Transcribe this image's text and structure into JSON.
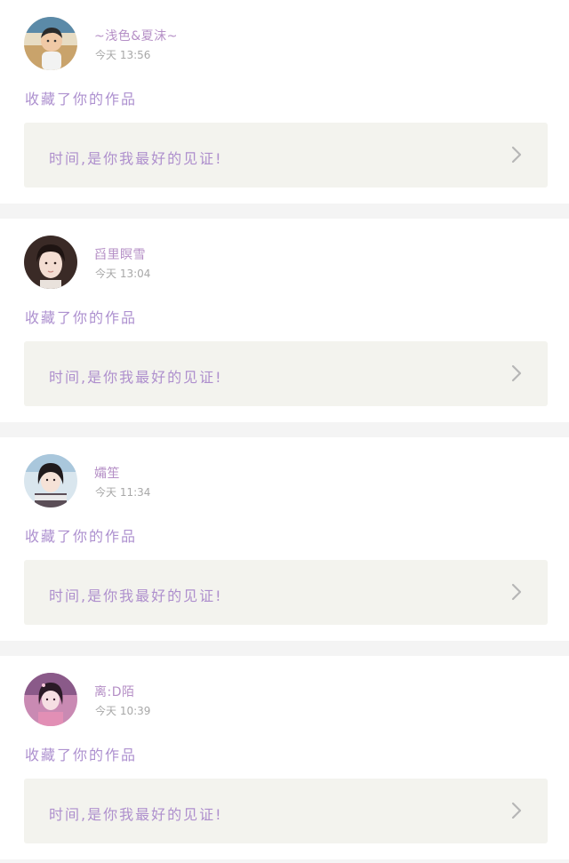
{
  "colors": {
    "name": "#b58fc6",
    "accent_text": "#ae8fcd",
    "time": "#a8a8a8",
    "card_bg": "#ffffff",
    "work_bg": "#f3f3ee",
    "divider": "#f4f4f4",
    "chevron": "#b6b6b6"
  },
  "notifications": [
    {
      "avatar": "boy-photo",
      "username": "~浅色&夏沫~",
      "time": "今天 13:56",
      "action": "收藏了你的作品",
      "work_title": "时间,是你我最好的见证!",
      "chevron_icon": "chevron-right-icon"
    },
    {
      "avatar": "woman-portrait",
      "username": "舀里瞑雪",
      "time": "今天 13:04",
      "action": "收藏了你的作品",
      "work_title": "时间,是你我最好的见证!",
      "chevron_icon": "chevron-right-icon"
    },
    {
      "avatar": "girl-photo",
      "username": "孀笙",
      "time": "今天 11:34",
      "action": "收藏了你的作品",
      "work_title": "时间,是你我最好的见证!",
      "chevron_icon": "chevron-right-icon"
    },
    {
      "avatar": "anime-girl-pink",
      "username": "离:D陌",
      "time": "今天 10:39",
      "action": "收藏了你的作品",
      "work_title": "时间,是你我最好的见证!",
      "chevron_icon": "chevron-right-icon"
    }
  ]
}
